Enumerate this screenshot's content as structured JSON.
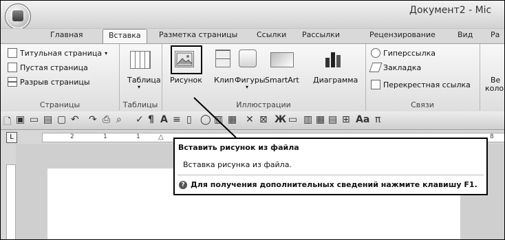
{
  "window": {
    "title": "Документ2 - Mic"
  },
  "tabs": [
    {
      "label": "Главная"
    },
    {
      "label": "Вставка",
      "active": true
    },
    {
      "label": "Разметка страницы"
    },
    {
      "label": "Ссылки"
    },
    {
      "label": "Рассылки"
    },
    {
      "label": "Рецензирование"
    },
    {
      "label": "Вид"
    },
    {
      "label": "Ра"
    }
  ],
  "ribbon": {
    "pages": {
      "items": [
        "Титульная страница",
        "Пустая страница",
        "Разрыв страницы"
      ],
      "label": "Страницы"
    },
    "tables": {
      "button": "Таблица",
      "label": "Таблицы"
    },
    "illustrations": {
      "buttons": [
        "Рисунок",
        "Клип",
        "Фигуры",
        "SmartArt",
        "Диаграмма"
      ],
      "label": "Иллюстрации"
    },
    "links": {
      "items": [
        "Гиперссылка",
        "Закладка",
        "Перекрестная ссылка"
      ],
      "label": "Связи"
    },
    "cut_right": [
      "Ве",
      "коло"
    ]
  },
  "ruler": {
    "left_marks": [
      "2",
      "1",
      "1"
    ],
    "right_mark": "8"
  },
  "tooltip": {
    "title": "Вставить рисунок из файла",
    "description": "Вставка рисунка из файла.",
    "help": "Для получения дополнительных сведений нажмите клавишу F1."
  },
  "icons": [
    "office-button-icon",
    "cover-page-icon",
    "blank-page-icon",
    "page-break-icon",
    "table-icon",
    "picture-icon",
    "clip-icon",
    "shapes-icon",
    "smartart-icon",
    "chart-icon",
    "hyperlink-icon",
    "bookmark-icon",
    "cross-reference-icon",
    "help-icon"
  ]
}
